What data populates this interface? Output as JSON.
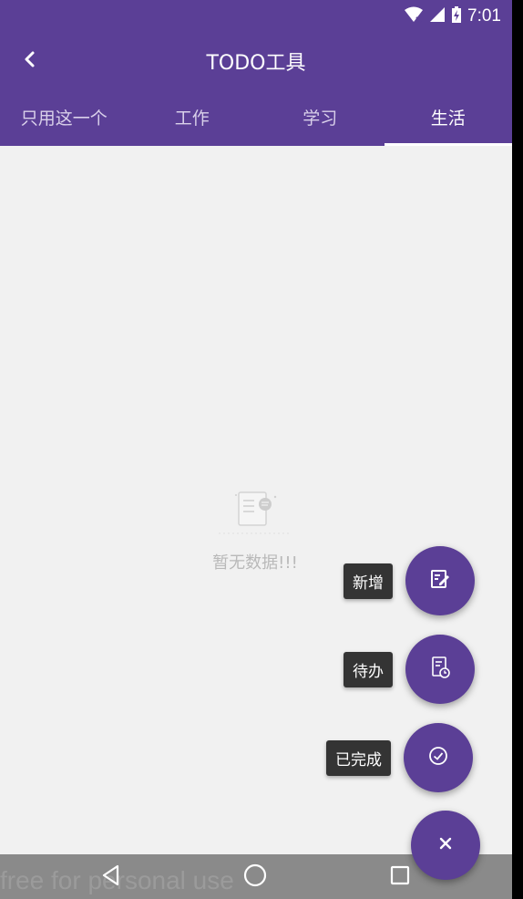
{
  "status_bar": {
    "time": "7:01"
  },
  "app_bar": {
    "title": "TODO工具"
  },
  "tabs": [
    {
      "label": "只用这一个",
      "active": false
    },
    {
      "label": "工作",
      "active": false
    },
    {
      "label": "学习",
      "active": false
    },
    {
      "label": "生活",
      "active": true
    }
  ],
  "empty_state": {
    "text": "暂无数据!!!"
  },
  "fab_menu": {
    "items": [
      {
        "label": "新增",
        "icon": "edit-note-icon"
      },
      {
        "label": "待办",
        "icon": "pending-clock-icon"
      },
      {
        "label": "已完成",
        "icon": "check-circle-icon"
      }
    ],
    "close_icon": "close-icon"
  },
  "watermark": "free for personal use",
  "colors": {
    "primary": "#5b3f96",
    "background": "#f1f1f1",
    "label_bg": "#343434"
  }
}
